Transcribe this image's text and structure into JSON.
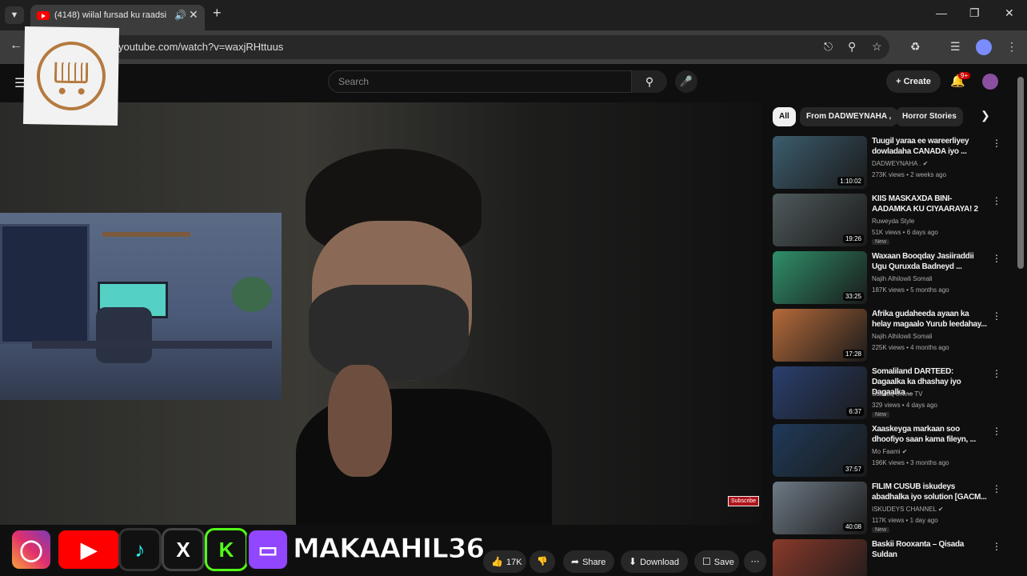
{
  "browser": {
    "tab_title": "(4148) wiilal fursad ku raadsi",
    "url": "youtube.com/watch?v=waxjRHttuus"
  },
  "youtube": {
    "search_placeholder": "Search",
    "create_label": "Create",
    "notif_badge": "9+"
  },
  "video": {
    "subscribe_mini": "Subscribe"
  },
  "overlay": {
    "handle": "MAKAAHIL36"
  },
  "actions": {
    "likes": "17K",
    "share": "Share",
    "download": "Download",
    "save": "Save"
  },
  "chips": [
    "All",
    "From DADWEYNAHA ,",
    "Horror Stories"
  ],
  "recommendations": [
    {
      "title": "Tuugil yaraa ee wareerliyey dowladaha CANADA iyo ...",
      "channel": "DADWEYNAHA .",
      "verified": true,
      "meta": "273K views • 2 weeks ago",
      "duration": "1:10:02",
      "badge": "",
      "thumb_color": "#3c5d6e"
    },
    {
      "title": "KIIS MASKAXDA BINI-AADAMKA KU CIYAARAYA! 2",
      "channel": "Ruweyda Style",
      "verified": false,
      "meta": "51K views • 6 days ago",
      "duration": "19:26",
      "badge": "New",
      "thumb_color": "#4f5a5c"
    },
    {
      "title": "Waxaan Booqday Jasiiraddii Ugu Quruxda Badneyd ...",
      "channel": "Najih Alhilowli Somali",
      "verified": false,
      "meta": "187K views • 5 months ago",
      "duration": "33:25",
      "badge": "",
      "thumb_color": "#2f8f6a"
    },
    {
      "title": "Afrika gudaheeda ayaan ka helay magaalo Yurub leedahay...",
      "channel": "Najih Alhilowli Somali",
      "verified": false,
      "meta": "225K views • 4 months ago",
      "duration": "17:28",
      "badge": "",
      "thumb_color": "#b56a3a"
    },
    {
      "title": "Somaliland DARTEED: Dagaalka ka dhashay iyo Dagaalka ...",
      "channel": "Saadaq online TV",
      "verified": false,
      "meta": "329 views • 4 days ago",
      "duration": "6:37",
      "badge": "New",
      "thumb_color": "#2a3f6e"
    },
    {
      "title": "Xaaskeyga markaan soo dhoofiyo saan kama fileyn, ...",
      "channel": "Mo Faami",
      "verified": true,
      "meta": "196K views • 3 months ago",
      "duration": "37:57",
      "badge": "",
      "thumb_color": "#1f3a5a"
    },
    {
      "title": "FILIM CUSUB iskudeys abadhalka iyo solution [GACM...",
      "channel": "ISKUDEYS CHANNEL",
      "verified": true,
      "meta": "117K views • 1 day ago",
      "duration": "40:08",
      "badge": "New",
      "thumb_color": "#6e7a86"
    },
    {
      "title": "Baskii Rooxanta – Qisada Suldan",
      "channel": "",
      "verified": false,
      "meta": "",
      "duration": "",
      "badge": "",
      "thumb_color": "#8a3a2a"
    }
  ]
}
